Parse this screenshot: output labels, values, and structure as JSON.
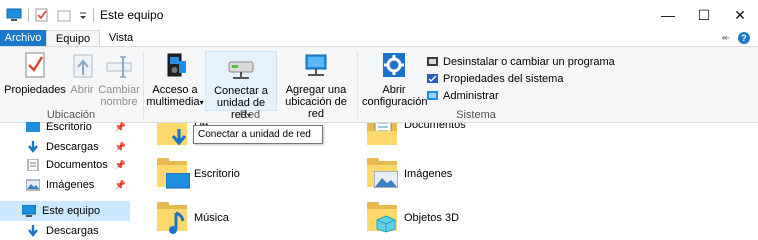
{
  "window": {
    "title": "Este equipo",
    "controls": {
      "minimize": "—",
      "maximize": "☐",
      "close": "✕"
    }
  },
  "tabs": [
    {
      "label": "Archivo"
    },
    {
      "label": "Equipo"
    },
    {
      "label": "Vista"
    }
  ],
  "ribbon": {
    "ubicacion": {
      "label": "Ubicación",
      "buttons": [
        {
          "label1": "Propiedades",
          "label2": ""
        },
        {
          "label1": "Abrir",
          "label2": ""
        },
        {
          "label1": "Cambiar",
          "label2": "nombre"
        }
      ]
    },
    "red": {
      "label": "Red",
      "buttons": [
        {
          "label1": "Acceso a",
          "label2": "multimedia"
        },
        {
          "label1": "Conectar a",
          "label2": "unidad de red"
        },
        {
          "label1": "Agregar una",
          "label2": "ubicación de red"
        }
      ]
    },
    "sistema": {
      "label": "Sistema",
      "big_button": {
        "label1": "Abrir",
        "label2": "configuración"
      },
      "items": [
        {
          "label": "Desinstalar o cambiar un programa"
        },
        {
          "label": "Propiedades del sistema"
        },
        {
          "label": "Administrar"
        }
      ]
    }
  },
  "tooltip": "Conectar a unidad de red",
  "nav": {
    "items": [
      {
        "label": "Escritorio"
      },
      {
        "label": "Descargas"
      },
      {
        "label": "Documentos"
      },
      {
        "label": "Imágenes"
      },
      {
        "label": "Este equipo"
      },
      {
        "label": "Descargas"
      }
    ]
  },
  "content": {
    "folders": [
      {
        "label": "De"
      },
      {
        "label": "Documentos"
      },
      {
        "label": "Escritorio"
      },
      {
        "label": "Imágenes"
      },
      {
        "label": "Música"
      },
      {
        "label": "Objetos 3D"
      }
    ]
  },
  "colors": {
    "accent": "#1979ca",
    "ribbon_bg": "#f5f6f7",
    "selected": "#cce8ff",
    "folder": "#ffd86b"
  }
}
